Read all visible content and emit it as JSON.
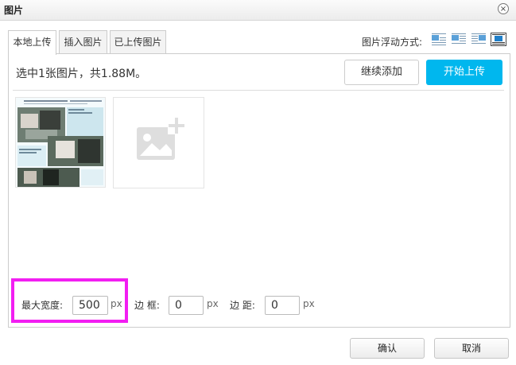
{
  "dialog": {
    "title": "图片",
    "close_icon": "×"
  },
  "tabs": [
    {
      "label": "本地上传",
      "active": true
    },
    {
      "label": "插入图片",
      "active": false
    },
    {
      "label": "已上传图片",
      "active": false
    }
  ],
  "float": {
    "label": "图片浮动方式:",
    "options": [
      "float-none-icon",
      "float-left-icon",
      "float-right-icon",
      "float-center-icon"
    ],
    "selected": "float-center-icon"
  },
  "upload": {
    "status": "选中1张图片，共1.88M。",
    "continue_label": "继续添加",
    "start_label": "开始上传"
  },
  "colors": {
    "accent": "#00b7ee",
    "highlight": "#f21ef2"
  },
  "fields": {
    "max_width_label": "最大宽度:",
    "max_width_value": "500",
    "border_label": "边 框:",
    "border_value": "0",
    "margin_label": "边 距:",
    "margin_value": "0",
    "unit": "px"
  },
  "footer": {
    "ok_label": "确认",
    "cancel_label": "取消"
  }
}
